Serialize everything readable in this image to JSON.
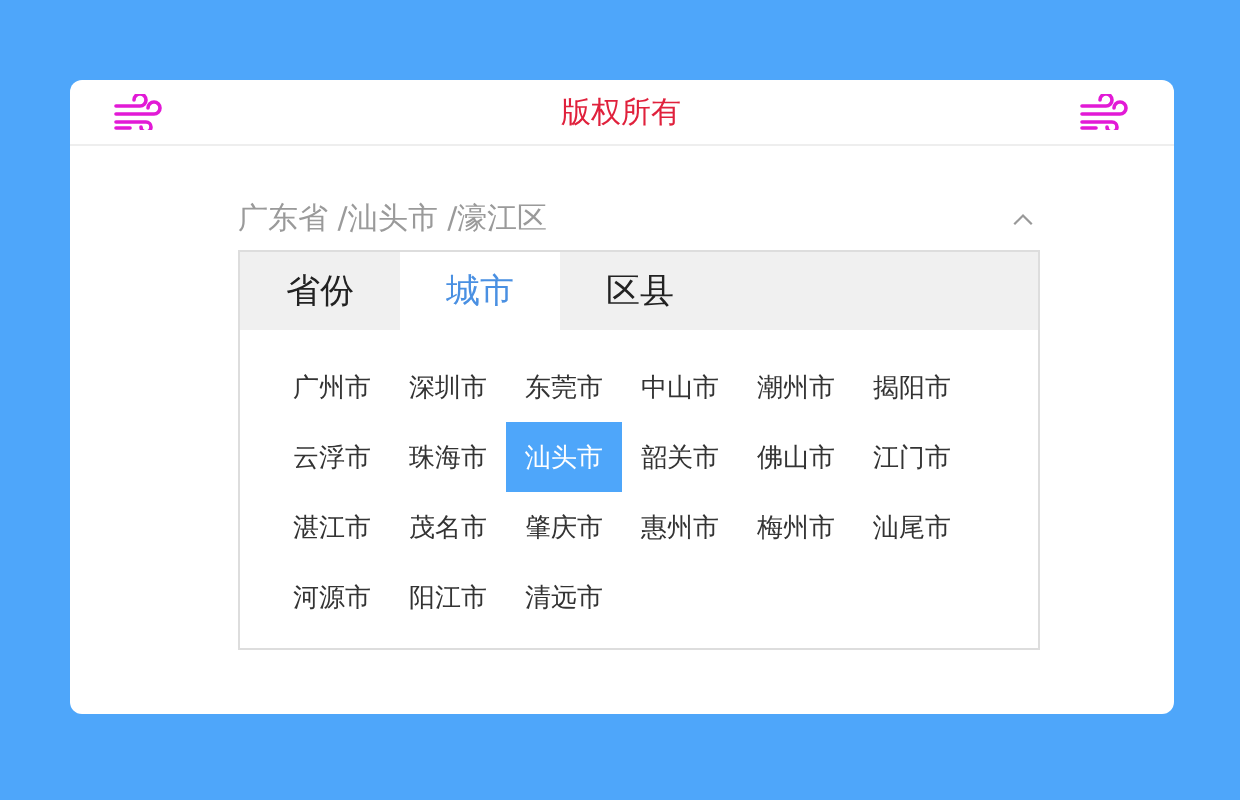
{
  "header": {
    "title": "版权所有"
  },
  "address": {
    "text": "广东省 /汕头市 /濠江区",
    "expanded": true
  },
  "tabs": [
    {
      "label": "省份",
      "selected": false
    },
    {
      "label": "城市",
      "selected": true
    },
    {
      "label": "区县",
      "selected": false
    }
  ],
  "cities": [
    {
      "label": "广州市",
      "selected": false
    },
    {
      "label": "深圳市",
      "selected": false
    },
    {
      "label": "东莞市",
      "selected": false
    },
    {
      "label": "中山市",
      "selected": false
    },
    {
      "label": "潮州市",
      "selected": false
    },
    {
      "label": "揭阳市",
      "selected": false
    },
    {
      "label": "云浮市",
      "selected": false
    },
    {
      "label": "珠海市",
      "selected": false
    },
    {
      "label": "汕头市",
      "selected": true
    },
    {
      "label": "韶关市",
      "selected": false
    },
    {
      "label": "佛山市",
      "selected": false
    },
    {
      "label": "江门市",
      "selected": false
    },
    {
      "label": "湛江市",
      "selected": false
    },
    {
      "label": "茂名市",
      "selected": false
    },
    {
      "label": "肇庆市",
      "selected": false
    },
    {
      "label": "惠州市",
      "selected": false
    },
    {
      "label": "梅州市",
      "selected": false
    },
    {
      "label": "汕尾市",
      "selected": false
    },
    {
      "label": "河源市",
      "selected": false
    },
    {
      "label": "阳江市",
      "selected": false
    },
    {
      "label": "清远市",
      "selected": false
    }
  ]
}
